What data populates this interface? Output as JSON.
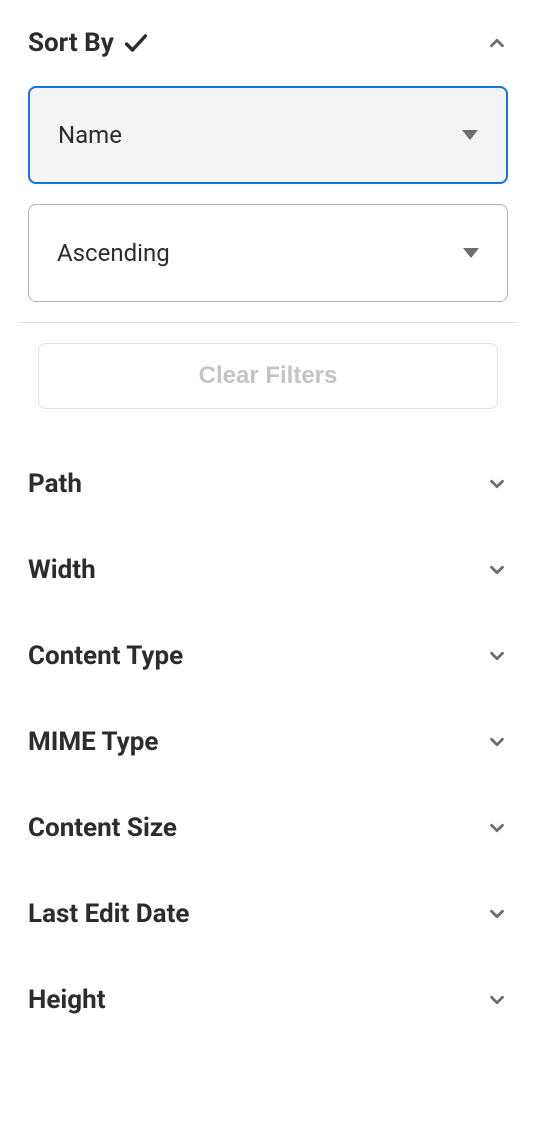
{
  "sort": {
    "title": "Sort By",
    "field_select": "Name",
    "direction_select": "Ascending"
  },
  "actions": {
    "clear_filters": "Clear Filters"
  },
  "filters": [
    {
      "label": "Path"
    },
    {
      "label": "Width"
    },
    {
      "label": "Content Type"
    },
    {
      "label": "MIME Type"
    },
    {
      "label": "Content Size"
    },
    {
      "label": "Last Edit Date"
    },
    {
      "label": "Height"
    }
  ]
}
